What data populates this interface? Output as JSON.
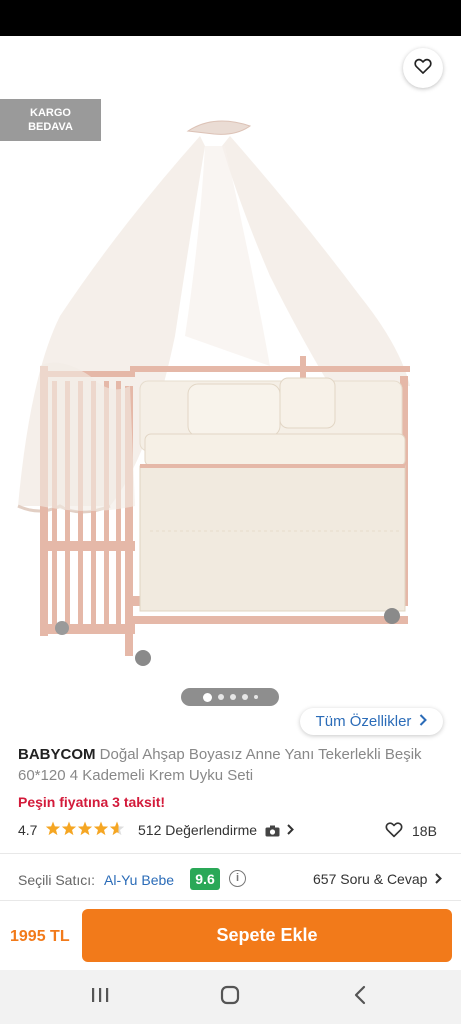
{
  "header": {
    "back_icon": "arrow-left-icon",
    "share_icon": "share-icon",
    "favorite_icon": "heart-outline-icon"
  },
  "badge": {
    "line1": "KARGO",
    "line2": "BEDAVA"
  },
  "gallery": {
    "page_count": 5,
    "active_index": 0
  },
  "all_features": {
    "label": "Tüm Özellikler",
    "icon": "chevron-right-icon"
  },
  "product": {
    "brand": "BABYCOM",
    "name": "Doğal Ahşap Boyasız Anne Yanı Tekerlekli Beşik 60*120 4 Kademeli Krem Uyku Seti",
    "installment_text": "Peşin fiyatına 3 taksit!",
    "rating": "4.7",
    "rating_value": 4.7,
    "review_count_text": "512 Değerlendirme",
    "camera_icon": "camera-icon",
    "favorite_count": "18B"
  },
  "seller": {
    "label": "Seçili Satıcı:",
    "name": "Al-Yu Bebe",
    "score": "9.6",
    "info_icon": "info-icon",
    "qa_text": "657 Soru & Cevap"
  },
  "purchase": {
    "price": "1995 TL",
    "button_label": "Sepete Ekle"
  },
  "colors": {
    "accent": "#f27a1a",
    "link": "#2b6cb8",
    "installment": "#d31a3a",
    "seller_score": "#2aa857",
    "star": "#f5a623"
  },
  "system_nav": {
    "recents_icon": "recents-icon",
    "home_icon": "home-icon",
    "back_icon": "system-back-icon"
  }
}
